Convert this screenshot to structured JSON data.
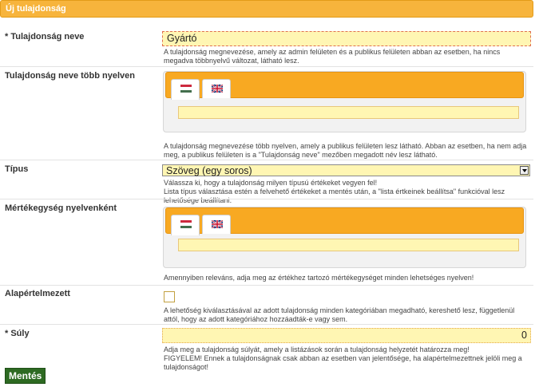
{
  "header": {
    "title": "Új tulajdonság"
  },
  "fields": {
    "name": {
      "label": "* Tulajdonság neve",
      "value": "Gyártó",
      "help": "A tulajdonság megnevezése, amely az admin felületen és a publikus felületen abban az esetben, ha nincs megadva többnyelvű változat, látható lesz."
    },
    "name_multilang": {
      "label": "Tulajdonság neve több nyelven",
      "help": "A tulajdonság megnevezése több nyelven, amely a publikus felületen lesz látható. Abban az esetben, ha nem adja meg, a publikus felületen is a \"Tulajdonság neve\" mezőben megadott név lesz látható.",
      "tabs": [
        "hu-flag",
        "uk-flag"
      ]
    },
    "type": {
      "label": "Típus",
      "selected": "Szöveg (egy soros)",
      "help_line1": "Válassza ki, hogy a tulajdonság milyen típusú értékeket vegyen fel!",
      "help_line2": "Lista típus választása estén a felvehető értékeket a mentés után, a \"lista értkeinek beállítsa\" funkcióval lesz lehetősége beállítani."
    },
    "unit": {
      "label": "Mértékegység nyelvenként",
      "help": "Amennyiben releváns, adja meg az értékhez tartozó mértékegységet minden lehetséges nyelven!"
    },
    "default": {
      "label": "Alapértelmezett",
      "checked": false,
      "help": "A lehetőség kiválasztásával az adott tulajdonság minden kategóriában megadható, kereshető lesz, függetlenül attól, hogy az adott kategóriához hozzáadták-e vagy sem."
    },
    "weight": {
      "label": "* Súly",
      "value": "0",
      "help_line1": "Adja meg a tulajdonság súlyát, amely a listázások során a tulajdonság helyzetét határozza meg!",
      "help_line2": "FIGYELEM! Ennek a tulajdonságnak csak abban az esetben van jelentősége, ha alapértelmezettnek jelöli meg a tulajdonságot!"
    }
  },
  "actions": {
    "save_label": "Mentés"
  },
  "colors": {
    "header": "#f7b43c",
    "input_bg": "#fff6b3",
    "save_button": "#2d6a22"
  }
}
